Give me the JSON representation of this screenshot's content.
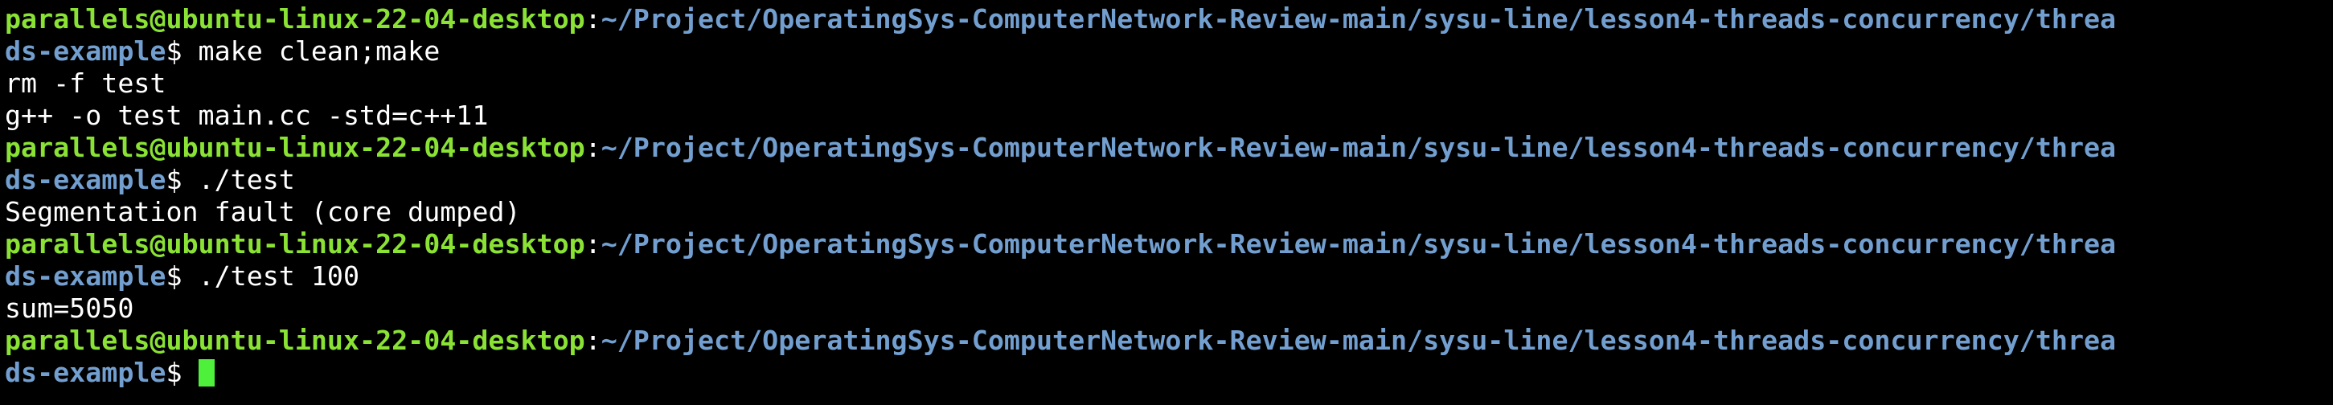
{
  "theme": {
    "background": "#000000",
    "prompt_user_color": "#8ae234",
    "prompt_path_color": "#729fcf",
    "text_color": "#ffffff",
    "cursor_color": "#4ff03b"
  },
  "prompt": {
    "user_host": "parallels@ubuntu-linux-22-04-desktop",
    "separator": ":",
    "path_part1": "~/Project/OperatingSys-ComputerNetwork-Review-main/sysu-line/lesson4-threads-concurrency/threa",
    "path_part2": "ds-example",
    "dollar": "$"
  },
  "session": [
    {
      "command": " make clean;make",
      "output": [
        "rm -f test",
        "g++ -o test main.cc -std=c++11"
      ]
    },
    {
      "command": " ./test",
      "output": [
        "Segmentation fault (core dumped)"
      ]
    },
    {
      "command": " ./test 100",
      "output": [
        "sum=5050"
      ]
    },
    {
      "command": " ",
      "output": []
    }
  ]
}
